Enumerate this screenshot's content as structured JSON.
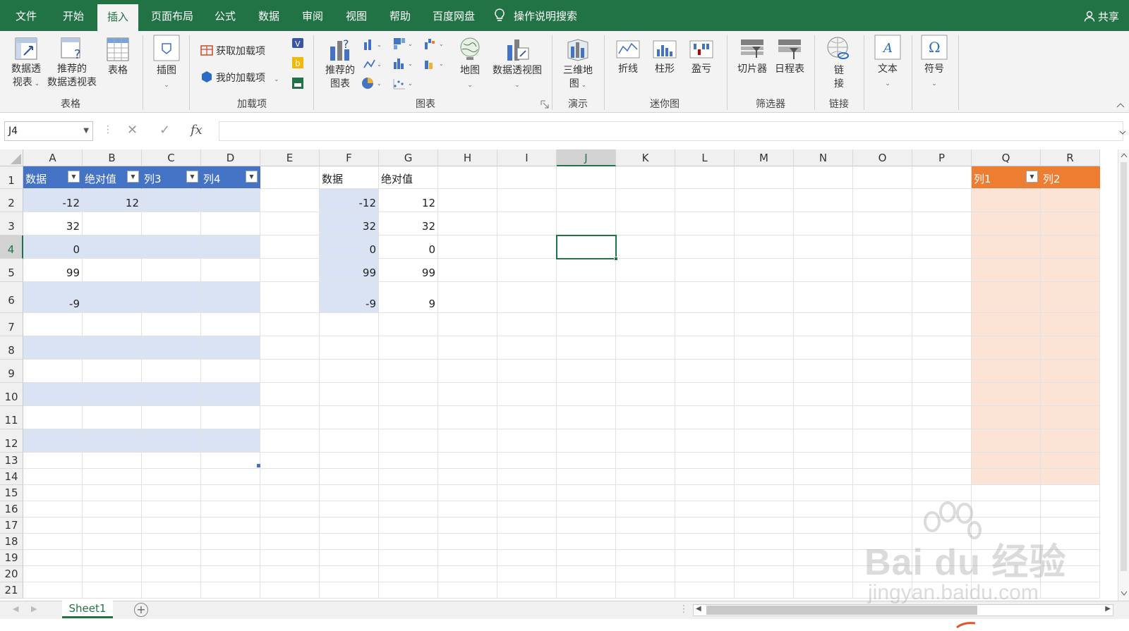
{
  "menu": {
    "tabs": [
      "文件",
      "开始",
      "插入",
      "页面布局",
      "公式",
      "数据",
      "审阅",
      "视图",
      "帮助",
      "百度网盘"
    ],
    "active_tab": "插入",
    "search_label": "操作说明搜索",
    "share_label": "共享"
  },
  "ribbon": {
    "tables": {
      "pivot_label_1": "数据透",
      "pivot_label_2": "视表",
      "recommended_pivot_1": "推荐的",
      "recommended_pivot_2": "数据透视表",
      "table_label": "表格",
      "group_label": "表格"
    },
    "illustrations": {
      "label": "插图"
    },
    "addins": {
      "get_addins": "获取加载项",
      "my_addins": "我的加载项",
      "group_label": "加载项"
    },
    "charts": {
      "recommended_1": "推荐的",
      "recommended_2": "图表",
      "map": "地图",
      "pivot_chart": "数据透视图",
      "group_label": "图表"
    },
    "tours": {
      "map3d_1": "三维地",
      "map3d_2": "图",
      "group_label": "演示"
    },
    "sparklines": {
      "line": "折线",
      "column": "柱形",
      "winloss": "盈亏",
      "group_label": "迷你图"
    },
    "filters": {
      "slicer": "切片器",
      "timeline": "日程表",
      "group_label": "筛选器"
    },
    "links": {
      "link_1": "链",
      "link_2": "接",
      "group_label": "链接"
    },
    "text": {
      "label": "文本"
    },
    "symbols": {
      "label": "符号"
    }
  },
  "formula_bar": {
    "name_box": "J4",
    "fx_label": "fx",
    "formula": ""
  },
  "columns": [
    "A",
    "B",
    "C",
    "D",
    "E",
    "F",
    "G",
    "H",
    "I",
    "J",
    "K",
    "L",
    "M",
    "N",
    "O",
    "P",
    "Q",
    "R"
  ],
  "rows": [
    "1",
    "2",
    "3",
    "4",
    "5",
    "6",
    "7",
    "8",
    "9",
    "10",
    "11",
    "12",
    "13",
    "14",
    "15",
    "16",
    "17",
    "18",
    "19",
    "20",
    "21"
  ],
  "selected_cell": {
    "col": "J",
    "row": "4"
  },
  "table1": {
    "headers": [
      "数据",
      "绝对值",
      "列3",
      "列4"
    ],
    "values": [
      [
        "-12",
        "12"
      ],
      [
        "32",
        ""
      ],
      [
        "0",
        ""
      ],
      [
        "99",
        ""
      ],
      [
        "-9",
        ""
      ]
    ]
  },
  "table2": {
    "headers": [
      "数据",
      "绝对值"
    ],
    "values": [
      [
        "-12",
        "12"
      ],
      [
        "32",
        "32"
      ],
      [
        "0",
        "0"
      ],
      [
        "99",
        "99"
      ],
      [
        "-9",
        "9"
      ]
    ]
  },
  "table3": {
    "headers": [
      "列1",
      "列2"
    ]
  },
  "sheets": [
    "Sheet1"
  ],
  "watermark": {
    "line1": "Bai du 经验",
    "line2": "jingyan.baidu.com"
  },
  "colors": {
    "excel_green": "#217346",
    "table_blue_header": "#4472c4",
    "table_blue_band": "#dae3f3",
    "table_orange_header": "#ed7d31",
    "table_orange_band": "#fbe4d5"
  }
}
